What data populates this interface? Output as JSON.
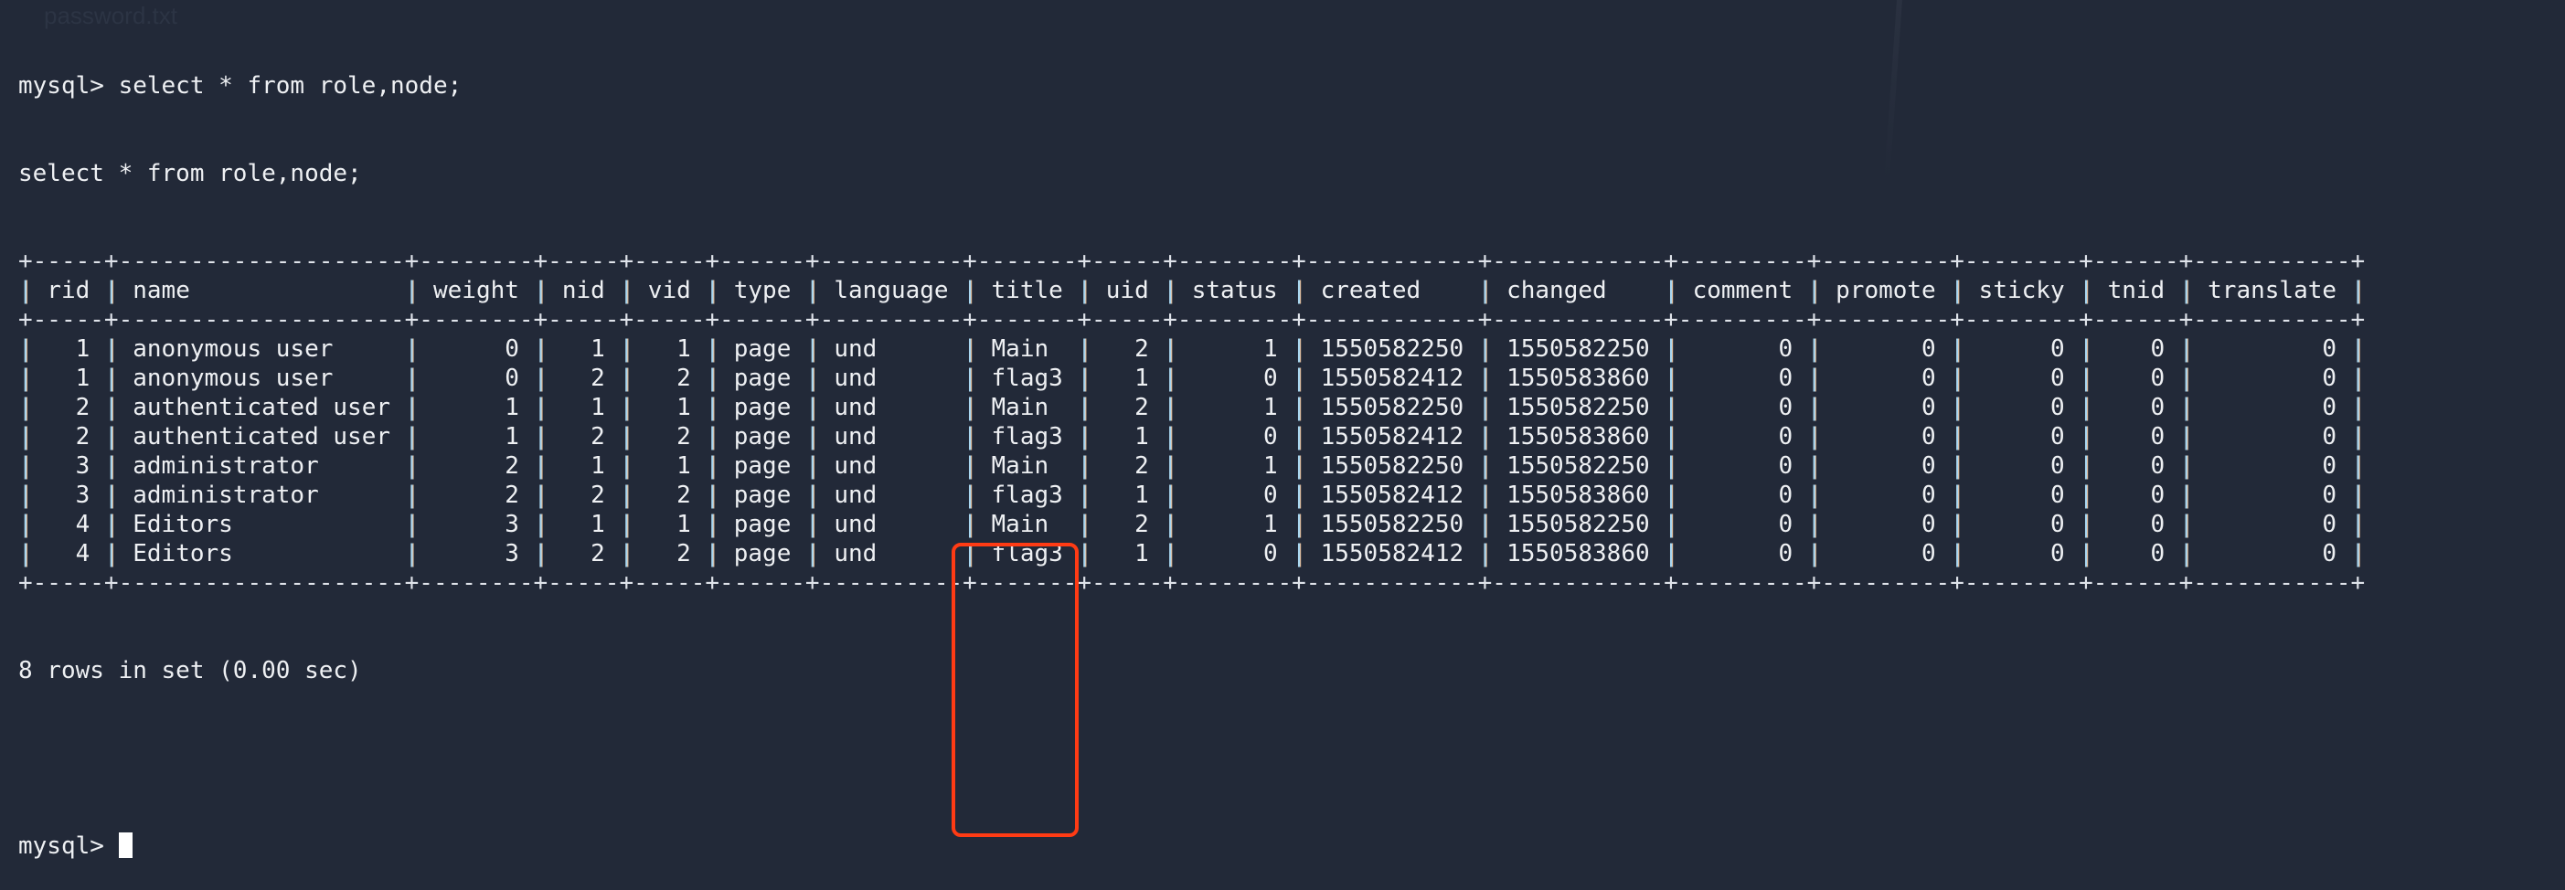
{
  "ghost_text": "password.txt",
  "command_line": "mysql> select * from role,node;",
  "echo_line": "select * from role,node;",
  "table": {
    "columns": [
      "rid",
      "name",
      "weight",
      "nid",
      "vid",
      "type",
      "language",
      "title",
      "uid",
      "status",
      "created",
      "changed",
      "comment",
      "promote",
      "sticky",
      "tnid",
      "translate"
    ],
    "right_aligned": [
      "rid",
      "weight",
      "nid",
      "vid",
      "uid",
      "status",
      "created",
      "changed",
      "comment",
      "promote",
      "sticky",
      "tnid",
      "translate"
    ],
    "rows": [
      [
        "1",
        "anonymous user",
        "0",
        "1",
        "1",
        "page",
        "und",
        "Main",
        "2",
        "1",
        "1550582250",
        "1550582250",
        "0",
        "0",
        "0",
        "0",
        "0"
      ],
      [
        "1",
        "anonymous user",
        "0",
        "2",
        "2",
        "page",
        "und",
        "flag3",
        "1",
        "0",
        "1550582412",
        "1550583860",
        "0",
        "0",
        "0",
        "0",
        "0"
      ],
      [
        "2",
        "authenticated user",
        "1",
        "1",
        "1",
        "page",
        "und",
        "Main",
        "2",
        "1",
        "1550582250",
        "1550582250",
        "0",
        "0",
        "0",
        "0",
        "0"
      ],
      [
        "2",
        "authenticated user",
        "1",
        "2",
        "2",
        "page",
        "und",
        "flag3",
        "1",
        "0",
        "1550582412",
        "1550583860",
        "0",
        "0",
        "0",
        "0",
        "0"
      ],
      [
        "3",
        "administrator",
        "2",
        "1",
        "1",
        "page",
        "und",
        "Main",
        "2",
        "1",
        "1550582250",
        "1550582250",
        "0",
        "0",
        "0",
        "0",
        "0"
      ],
      [
        "3",
        "administrator",
        "2",
        "2",
        "2",
        "page",
        "und",
        "flag3",
        "1",
        "0",
        "1550582412",
        "1550583860",
        "0",
        "0",
        "0",
        "0",
        "0"
      ],
      [
        "4",
        "Editors",
        "3",
        "1",
        "1",
        "page",
        "und",
        "Main",
        "2",
        "1",
        "1550582250",
        "1550582250",
        "0",
        "0",
        "0",
        "0",
        "0"
      ],
      [
        "4",
        "Editors",
        "3",
        "2",
        "2",
        "page",
        "und",
        "flag3",
        "1",
        "0",
        "1550582412",
        "1550583860",
        "0",
        "0",
        "0",
        "0",
        "0"
      ]
    ],
    "highlighted_column": "title"
  },
  "result_summary": "8 rows in set (0.00 sec)",
  "prompt": "mysql> ",
  "colors": {
    "background": "#222938",
    "highlight": "#ff3b14",
    "separator": "#a8d6f0"
  }
}
